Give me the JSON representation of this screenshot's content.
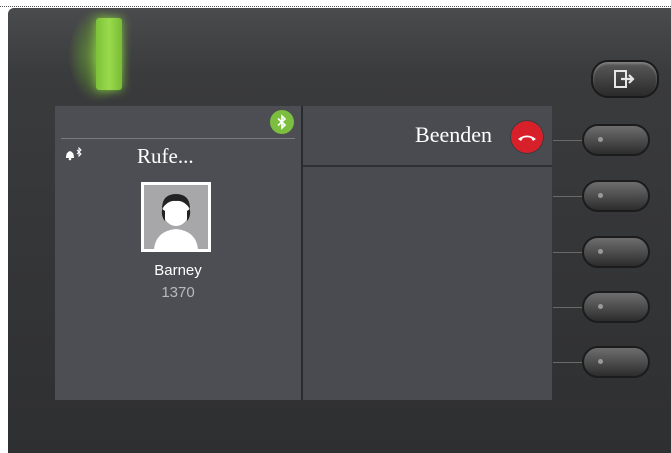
{
  "call": {
    "status_text": "Rufe...",
    "contact_name": "Barney",
    "contact_number": "1370"
  },
  "actions": {
    "end_label": "Beenden"
  },
  "icons": {
    "exit": "exit-door-icon",
    "bluetooth": "bluetooth-icon",
    "ringer": "bell-bluetooth-icon",
    "end_call": "hang-up-icon",
    "avatar": "person-silhouette"
  },
  "colors": {
    "led": "#8ccf45",
    "bluetooth_badge": "#7cbf3f",
    "end_call": "#d8202a",
    "screen_bg": "#4a4b51"
  },
  "softkeys_count": 5
}
